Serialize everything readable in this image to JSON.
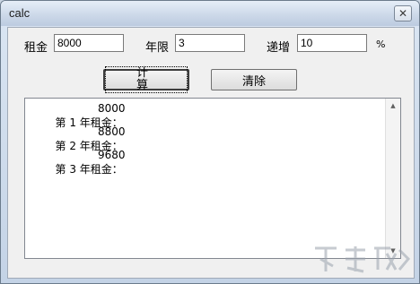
{
  "window": {
    "title": "calc",
    "close_symbol": "✕"
  },
  "form": {
    "rent_label": "租金",
    "rent_value": "8000",
    "years_label": "年限",
    "years_value": "3",
    "increase_label": "递增",
    "increase_value": "10",
    "percent_symbol": "%"
  },
  "buttons": {
    "calculate": "计算",
    "clear": "清除"
  },
  "output": {
    "lines": [
      {
        "label": "第 1 年租金：",
        "value": "8000"
      },
      {
        "label": "第 2 年租金：",
        "value": "8800"
      },
      {
        "label": "第 3 年租金：",
        "value": "9680"
      }
    ]
  },
  "scrollbar": {
    "up_icon": "▲",
    "down_icon": "▼"
  }
}
